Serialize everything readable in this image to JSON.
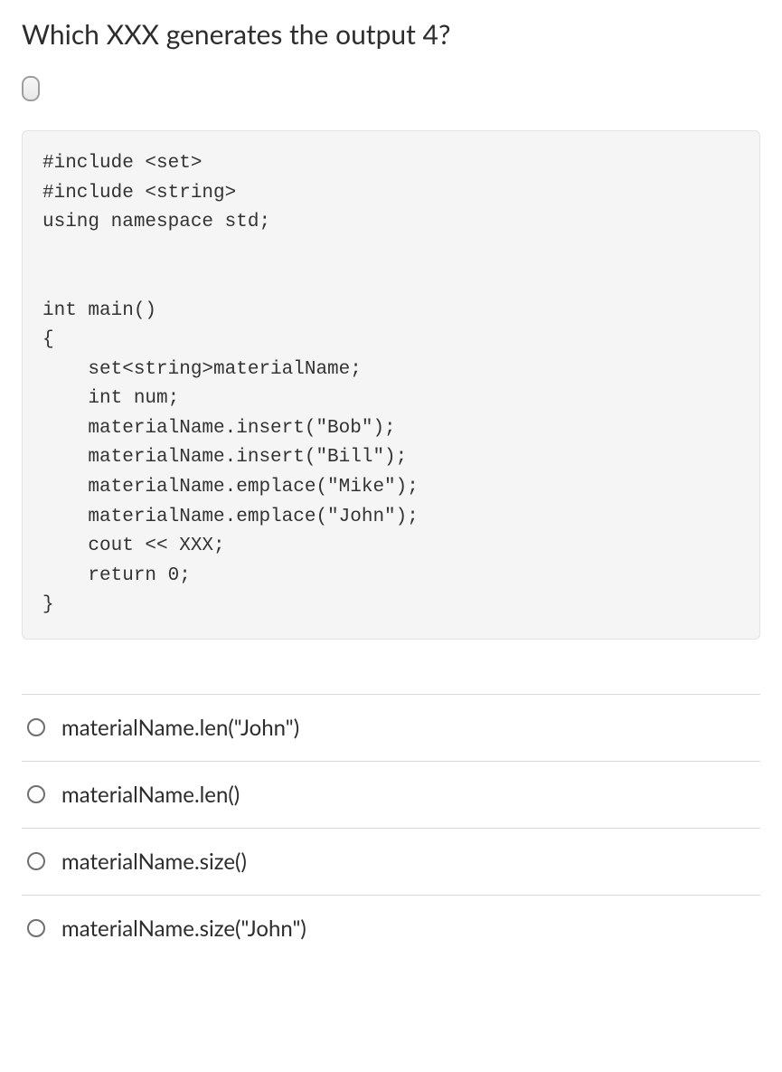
{
  "question": {
    "title": "Which XXX generates the output 4?"
  },
  "code": "#include <set>\n#include <string>\nusing namespace std;\n\n\nint main()\n{\n    set<string>materialName;\n    int num;\n    materialName.insert(\"Bob\");\n    materialName.insert(\"Bill\");\n    materialName.emplace(\"Mike\");\n    materialName.emplace(\"John\");\n    cout << XXX;\n    return 0;\n}",
  "options": [
    {
      "label": "materialName.len(\"John\")"
    },
    {
      "label": "materialName.len()"
    },
    {
      "label": "materialName.size()"
    },
    {
      "label": "materialName.size(\"John\")"
    }
  ]
}
